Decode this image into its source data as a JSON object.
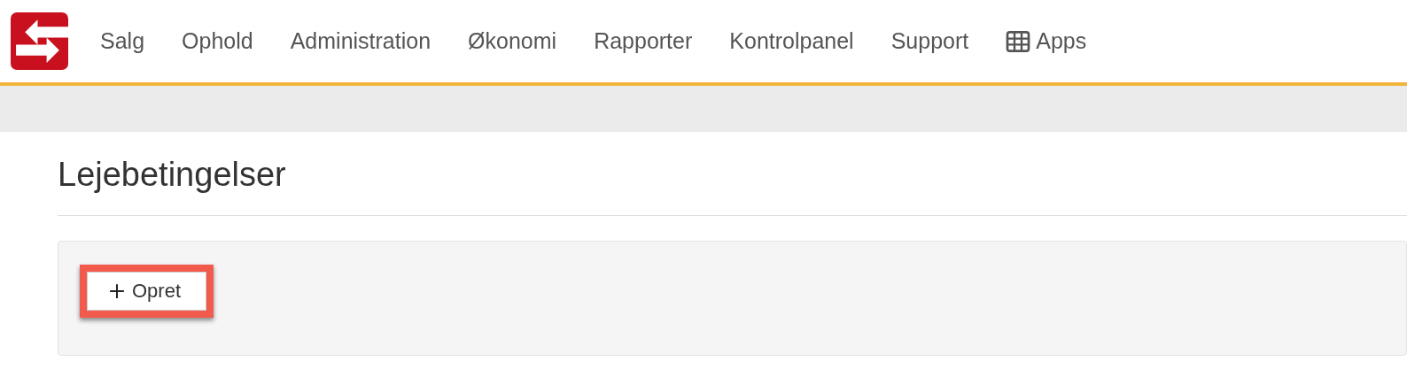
{
  "nav": {
    "items": [
      {
        "label": "Salg",
        "kind": "link"
      },
      {
        "label": "Ophold",
        "kind": "link"
      },
      {
        "label": "Administration",
        "kind": "link"
      },
      {
        "label": "Økonomi",
        "kind": "link"
      },
      {
        "label": "Rapporter",
        "kind": "link"
      },
      {
        "label": "Kontrolpanel",
        "kind": "link"
      },
      {
        "label": "Support",
        "kind": "link"
      },
      {
        "label": "Apps",
        "kind": "apps"
      }
    ]
  },
  "page": {
    "title": "Lejebetingelser",
    "create_button": {
      "label": "Opret",
      "highlighted": true
    }
  }
}
